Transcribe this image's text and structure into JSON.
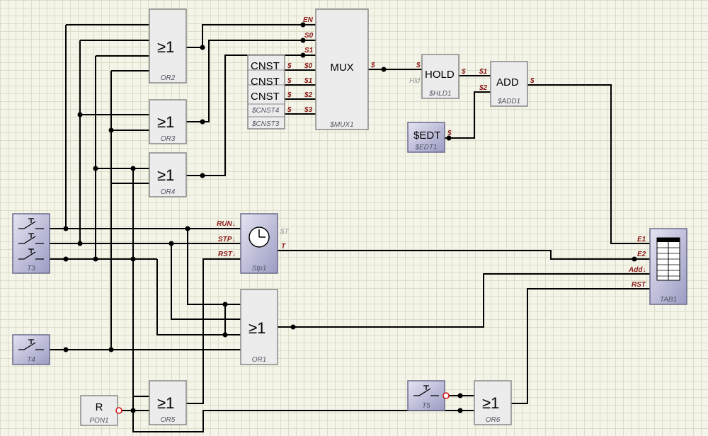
{
  "blocks": {
    "or2": {
      "symbol": "≥1",
      "name": "OR2"
    },
    "or3": {
      "symbol": "≥1",
      "name": "OR3"
    },
    "or4": {
      "symbol": "≥1",
      "name": "OR4"
    },
    "or1": {
      "symbol": "≥1",
      "name": "OR1"
    },
    "or5": {
      "symbol": "≥1",
      "name": "OR5"
    },
    "or6": {
      "symbol": "≥1",
      "name": "OR6"
    },
    "mux": {
      "symbol": "MUX",
      "name": "$MUX1",
      "pins": [
        "EN",
        "S0",
        "S1",
        "$0",
        "$1",
        "$2",
        "$3"
      ],
      "out": "$"
    },
    "cnst": {
      "symbol": "CNST",
      "names": [
        "$CNST4",
        "$CNST3"
      ],
      "out": "$"
    },
    "hold": {
      "symbol": "HOLD",
      "name": "$HLD1",
      "in": "$",
      "hld": "Hld",
      "out": "$"
    },
    "add": {
      "symbol": "ADD",
      "name": "$ADD1",
      "in1": "$1",
      "in2": "$2",
      "out": "$"
    },
    "edt": {
      "symbol": "$EDT",
      "name": "$EDT1",
      "out": "$"
    },
    "stp": {
      "name": "Stp1",
      "pins": [
        "RUN↓",
        "STP↓",
        "RST↓"
      ],
      "out_t_grey": "$T",
      "out_t": "T"
    },
    "tab": {
      "name": "TAB1",
      "pins": [
        "E1",
        "E2",
        "Add↓",
        "RST"
      ]
    },
    "t3": {
      "name": "T3"
    },
    "t4": {
      "name": "T4"
    },
    "t5": {
      "name": "T5"
    },
    "pon": {
      "symbol": "R",
      "name": "PON1"
    }
  },
  "colors": {
    "block": "#ececec",
    "blue_block": "#b8b8d8",
    "pin_label": "#8b1a1a",
    "grid": "#dcdcc8",
    "background": "#f4f4e8"
  }
}
